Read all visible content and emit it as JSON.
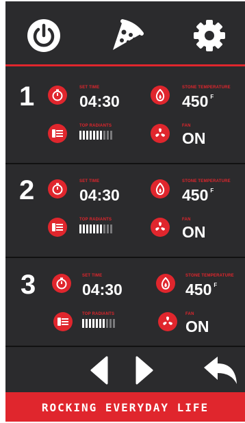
{
  "header": {
    "icons": [
      "power-icon",
      "pizza-icon",
      "gear-icon"
    ]
  },
  "ovens": [
    {
      "number": "1",
      "set_time_label": "SET TIME",
      "set_time": "04:30",
      "stone_temp_label": "STONE TEMPERATURE",
      "stone_temp": "450",
      "temp_unit": "F",
      "top_radiants_label": "TOP RADIANTS",
      "top_radiants_level": 0.7,
      "fan_label": "FAN",
      "fan": "ON"
    },
    {
      "number": "2",
      "set_time_label": "SET TIME",
      "set_time": "04:30",
      "stone_temp_label": "STONE TEMPERATURE",
      "stone_temp": "450",
      "temp_unit": "F",
      "top_radiants_label": "TOP RADIANTS",
      "top_radiants_level": 0.7,
      "fan_label": "FAN",
      "fan": "ON"
    },
    {
      "number": "3",
      "set_time_label": "SET TIME",
      "set_time": "04:30",
      "stone_temp_label": "STONE TEMPERATURE",
      "stone_temp": "450",
      "temp_unit": "F",
      "top_radiants_label": "TOP RADIANTS",
      "top_radiants_level": 0.7,
      "fan_label": "FAN",
      "fan": "ON"
    }
  ],
  "nav": {
    "icons": [
      "prev-arrow-icon",
      "next-arrow-icon",
      "back-icon"
    ]
  },
  "footer": {
    "slogan": "ROCKING EVERYDAY LIFE"
  },
  "colors": {
    "accent": "#e0262d",
    "background": "#2b2b2d",
    "text": "#ffffff"
  }
}
